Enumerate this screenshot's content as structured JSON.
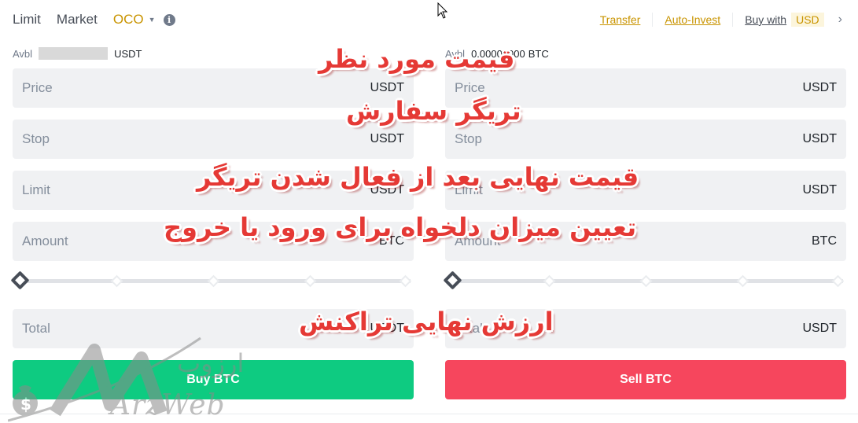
{
  "header": {
    "tabs": [
      {
        "label": "Limit",
        "active": false
      },
      {
        "label": "Market",
        "active": false
      },
      {
        "label": "OCO",
        "active": true
      }
    ],
    "dropdown_icon": "caret-down-icon",
    "info_icon": "info-icon",
    "links": {
      "transfer": "Transfer",
      "auto_invest": "Auto-Invest",
      "buy_with": "Buy with",
      "currency": "USD"
    }
  },
  "buy_panel": {
    "avbl_label": "Avbl",
    "avbl_value": "",
    "avbl_unit": "USDT",
    "fields": [
      {
        "label": "Price",
        "unit": "USDT"
      },
      {
        "label": "Stop",
        "unit": "USDT"
      },
      {
        "label": "Limit",
        "unit": "USDT"
      },
      {
        "label": "Amount",
        "unit": "BTC"
      }
    ],
    "slider_percent": 0,
    "total": {
      "label": "Total",
      "unit": "USDT"
    },
    "button": "Buy BTC"
  },
  "sell_panel": {
    "avbl_label": "Avbl",
    "avbl_value": "0.00000000",
    "avbl_unit": "BTC",
    "fields": [
      {
        "label": "Price",
        "unit": "USDT"
      },
      {
        "label": "Stop",
        "unit": "USDT"
      },
      {
        "label": "Limit",
        "unit": "USDT"
      },
      {
        "label": "Amount",
        "unit": "BTC"
      }
    ],
    "slider_percent": 0,
    "total": {
      "label": "Total",
      "unit": "USDT"
    },
    "button": "Sell BTC"
  },
  "annotations": [
    "قیمت مورد نظر",
    "تریگر سفارش",
    "قیمت نهایی بعد از فعال شدن تریگر",
    "تعیین میزان دلخواه برای ورود یا خروج",
    "ارزش نهایی تراکنش"
  ],
  "watermark": {
    "latin": "ArzWeb",
    "persian": "ارزوب"
  },
  "colors": {
    "accent": "#c99400",
    "buy": "#0ecb81",
    "sell": "#f6465d",
    "field_bg": "#f0f1f3",
    "annotation": "#e53935"
  }
}
